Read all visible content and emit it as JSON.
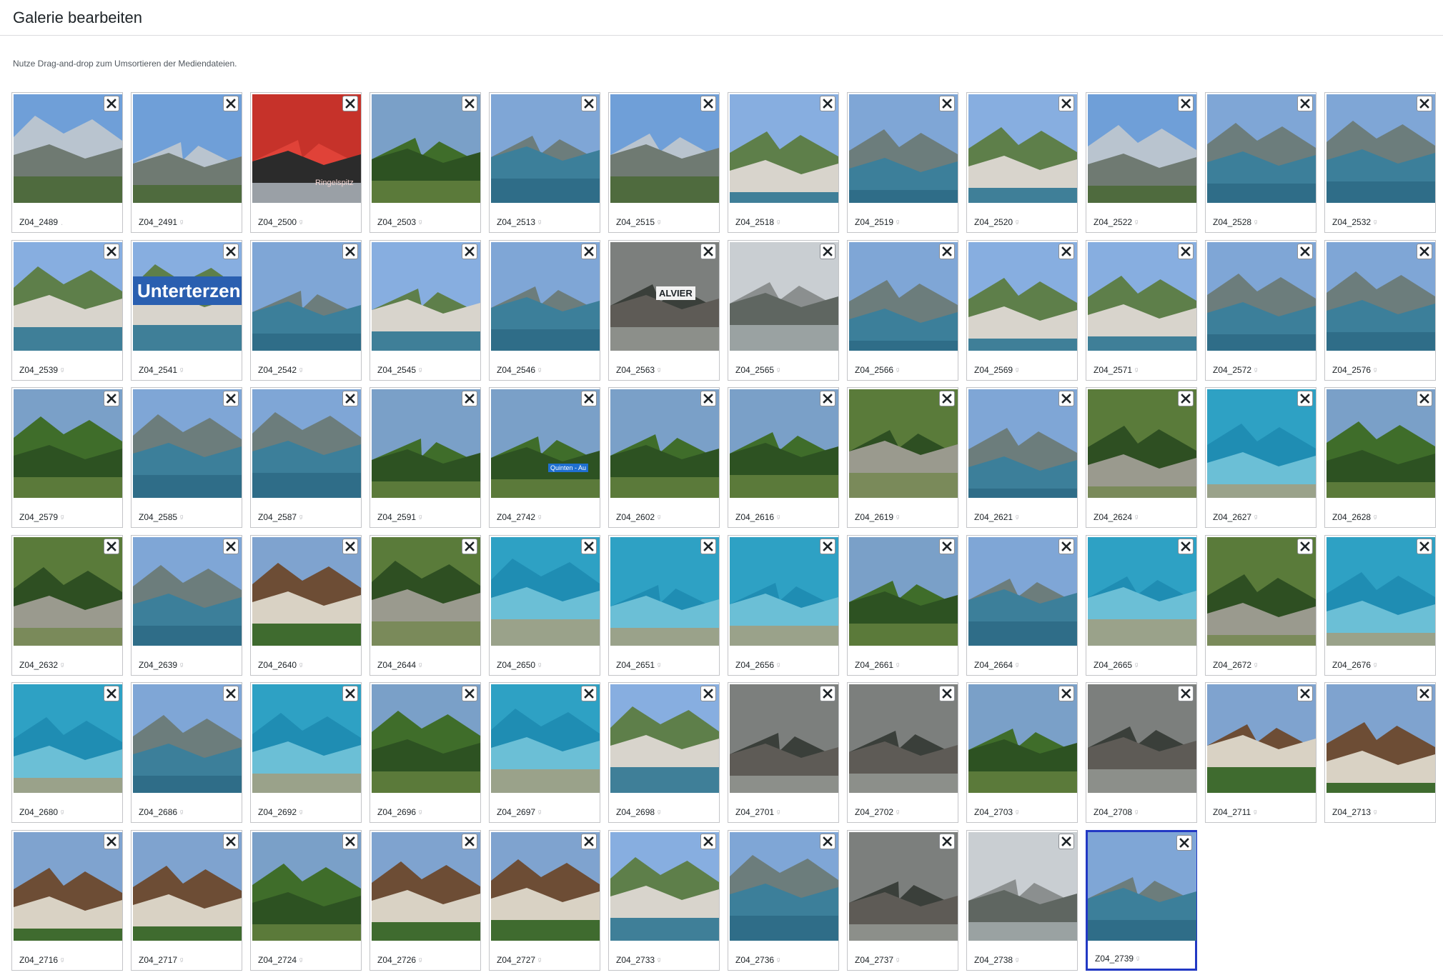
{
  "page": {
    "title": "Galerie bearbeiten",
    "instructions": "Nutze Drag-and-drop zum Umsortieren der Mediendateien."
  },
  "colors": {
    "selection_border": "#2239c4",
    "tile_border": "#c3c4c7"
  },
  "gallery": {
    "selected": "Z04_2739",
    "items": [
      {
        "label": "Z04_2489",
        "ghost": "."
      },
      {
        "label": "Z04_2491",
        "ghost": "ᵍ"
      },
      {
        "label": "Z04_2500",
        "ghost": "ᵍ"
      },
      {
        "label": "Z04_2503",
        "ghost": "ᵍ"
      },
      {
        "label": "Z04_2513",
        "ghost": "ᵍ"
      },
      {
        "label": "Z04_2515",
        "ghost": "ᵍ"
      },
      {
        "label": "Z04_2518",
        "ghost": "ᵍ"
      },
      {
        "label": "Z04_2519",
        "ghost": "ᵍ"
      },
      {
        "label": "Z04_2520",
        "ghost": "ᵍ"
      },
      {
        "label": "Z04_2522",
        "ghost": "ᵍ"
      },
      {
        "label": "Z04_2528",
        "ghost": "ᵍ"
      },
      {
        "label": "Z04_2532",
        "ghost": "ᵍ"
      },
      {
        "label": "Z04_2539",
        "ghost": "ᵍ"
      },
      {
        "label": "Z04_2541",
        "ghost": "ᵍ"
      },
      {
        "label": "Z04_2542",
        "ghost": "ᵍ"
      },
      {
        "label": "Z04_2545",
        "ghost": "ᵍ"
      },
      {
        "label": "Z04_2546",
        "ghost": "ᵍ"
      },
      {
        "label": "Z04_2563",
        "ghost": "ᵍ"
      },
      {
        "label": "Z04_2565",
        "ghost": "ᵍ"
      },
      {
        "label": "Z04_2566",
        "ghost": "ᵍ"
      },
      {
        "label": "Z04_2569",
        "ghost": "ᵍ"
      },
      {
        "label": "Z04_2571",
        "ghost": "ᵍ"
      },
      {
        "label": "Z04_2572",
        "ghost": "ᵍ"
      },
      {
        "label": "Z04_2576",
        "ghost": "ᵍ"
      },
      {
        "label": "Z04_2579",
        "ghost": "ᵍ"
      },
      {
        "label": "Z04_2585",
        "ghost": "ᵍ"
      },
      {
        "label": "Z04_2587",
        "ghost": "ᵍ"
      },
      {
        "label": "Z04_2591",
        "ghost": "ᵍ"
      },
      {
        "label": "Z04_2742",
        "ghost": "ᵍ"
      },
      {
        "label": "Z04_2602",
        "ghost": "ᵍ"
      },
      {
        "label": "Z04_2616",
        "ghost": "ᵍ"
      },
      {
        "label": "Z04_2619",
        "ghost": "ᵍ"
      },
      {
        "label": "Z04_2621",
        "ghost": "ᵍ"
      },
      {
        "label": "Z04_2624",
        "ghost": "ᵍ"
      },
      {
        "label": "Z04_2627",
        "ghost": "ᵍ"
      },
      {
        "label": "Z04_2628",
        "ghost": "ᵍ"
      },
      {
        "label": "Z04_2632",
        "ghost": "ᵍ"
      },
      {
        "label": "Z04_2639",
        "ghost": "ᵍ"
      },
      {
        "label": "Z04_2640",
        "ghost": "ᵍ"
      },
      {
        "label": "Z04_2644",
        "ghost": "ᵍ"
      },
      {
        "label": "Z04_2650",
        "ghost": "ᵍ"
      },
      {
        "label": "Z04_2651",
        "ghost": "ᵍ"
      },
      {
        "label": "Z04_2656",
        "ghost": "ᵍ"
      },
      {
        "label": "Z04_2661",
        "ghost": "ᵍ"
      },
      {
        "label": "Z04_2664",
        "ghost": "ᵍ"
      },
      {
        "label": "Z04_2665",
        "ghost": "ᵍ"
      },
      {
        "label": "Z04_2672",
        "ghost": "ᵍ"
      },
      {
        "label": "Z04_2676",
        "ghost": "ᵍ"
      },
      {
        "label": "Z04_2680",
        "ghost": "ᵍ"
      },
      {
        "label": "Z04_2686",
        "ghost": "ᵍ"
      },
      {
        "label": "Z04_2692",
        "ghost": "ᵍ"
      },
      {
        "label": "Z04_2696",
        "ghost": "ᵍ"
      },
      {
        "label": "Z04_2697",
        "ghost": "ᵍ"
      },
      {
        "label": "Z04_2698",
        "ghost": "ᵍ"
      },
      {
        "label": "Z04_2701",
        "ghost": "ᵍ"
      },
      {
        "label": "Z04_2702",
        "ghost": "ᵍ"
      },
      {
        "label": "Z04_2703",
        "ghost": "ᵍ"
      },
      {
        "label": "Z04_2708",
        "ghost": "ᵍ"
      },
      {
        "label": "Z04_2711",
        "ghost": "ᵍ"
      },
      {
        "label": "Z04_2713",
        "ghost": "ᵍ"
      },
      {
        "label": "Z04_2716",
        "ghost": "ᵍ"
      },
      {
        "label": "Z04_2717",
        "ghost": "ᵍ"
      },
      {
        "label": "Z04_2724",
        "ghost": "ᵍ"
      },
      {
        "label": "Z04_2726",
        "ghost": "ᵍ"
      },
      {
        "label": "Z04_2727",
        "ghost": "ᵍ"
      },
      {
        "label": "Z04_2733",
        "ghost": "ᵍ"
      },
      {
        "label": "Z04_2736",
        "ghost": "ᵍ"
      },
      {
        "label": "Z04_2737",
        "ghost": "ᵍ"
      },
      {
        "label": "Z04_2738",
        "ghost": "ᵍ"
      },
      {
        "label": "Z04_2739",
        "ghost": "ᵍ"
      }
    ]
  },
  "thumb_text": {
    "Z04_2500": "Ringelspitz",
    "Z04_2541": "Unterterzen",
    "Z04_2563": "ALVIER",
    "Z04_2742": "Quinten - Au"
  }
}
